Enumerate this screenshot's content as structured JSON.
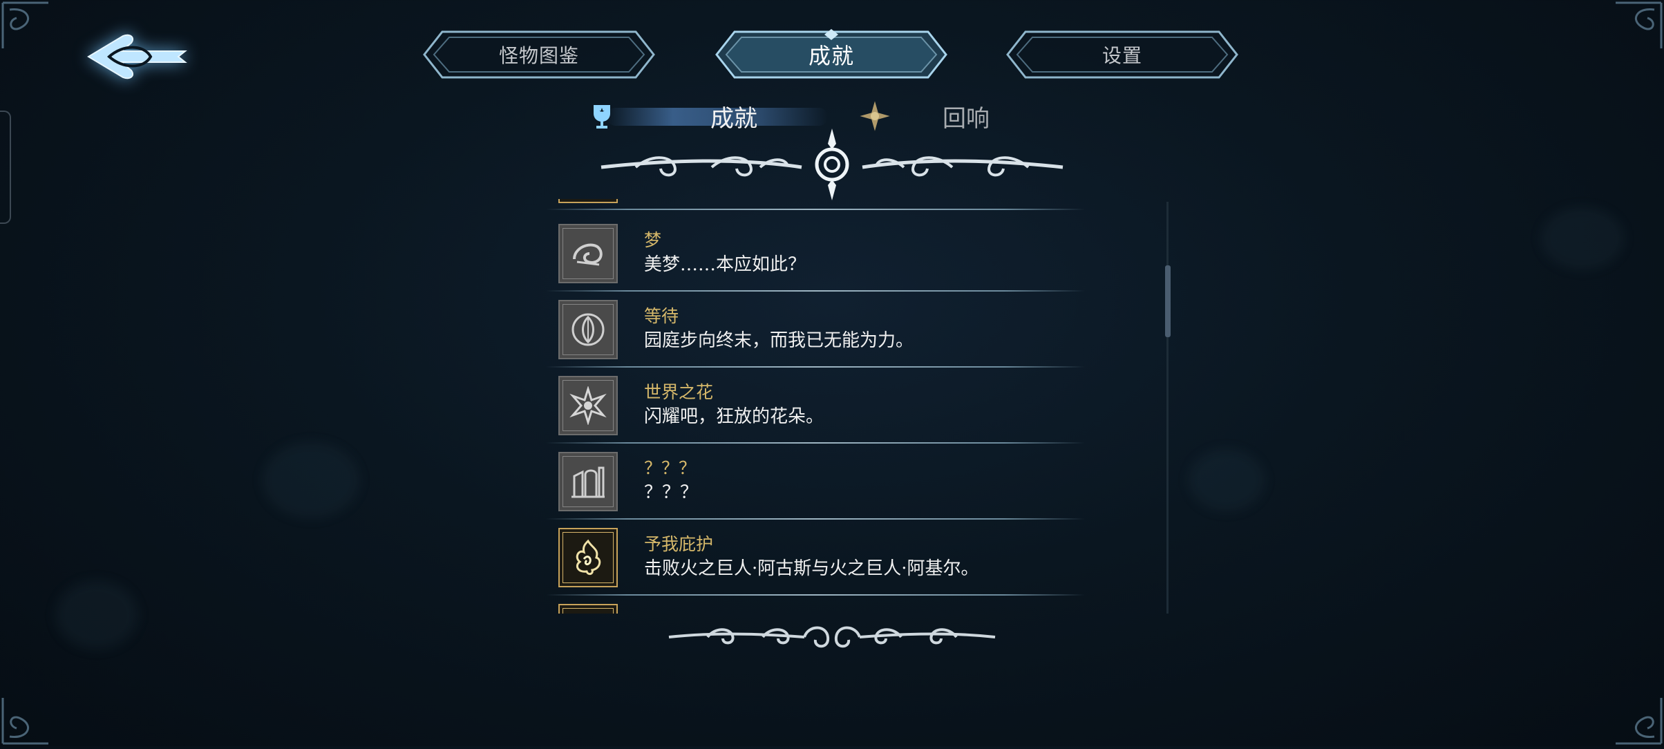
{
  "top_tabs": [
    {
      "label": "怪物图鉴",
      "active": false
    },
    {
      "label": "成就",
      "active": true
    },
    {
      "label": "设置",
      "active": false
    }
  ],
  "sub_tabs": [
    {
      "label": "成就",
      "icon": "trophy-icon",
      "active": true
    },
    {
      "label": "回响",
      "icon": "flower-star-icon",
      "active": false
    }
  ],
  "achievements": [
    {
      "title": "梦",
      "desc": "美梦……本应如此？",
      "icon": "shell-icon",
      "unlocked": false
    },
    {
      "title": "等待",
      "desc": "园庭步向终末，而我已无能为力。",
      "icon": "leaf-medallion-icon",
      "unlocked": false
    },
    {
      "title": "世界之花",
      "desc": "闪耀吧，狂放的花朵。",
      "icon": "flower-icon",
      "unlocked": false
    },
    {
      "title": "？？？",
      "desc": "？？？",
      "icon": "ruin-door-icon",
      "unlocked": false
    },
    {
      "title": "予我庇护",
      "desc": "击败火之巨人·阿古斯与火之巨人·阿基尔。",
      "icon": "fire-sigil-icon",
      "unlocked": true
    }
  ],
  "colors": {
    "accent": "#8fd4ff",
    "title_gold": "#d6b86a",
    "background": "#0a1620"
  }
}
